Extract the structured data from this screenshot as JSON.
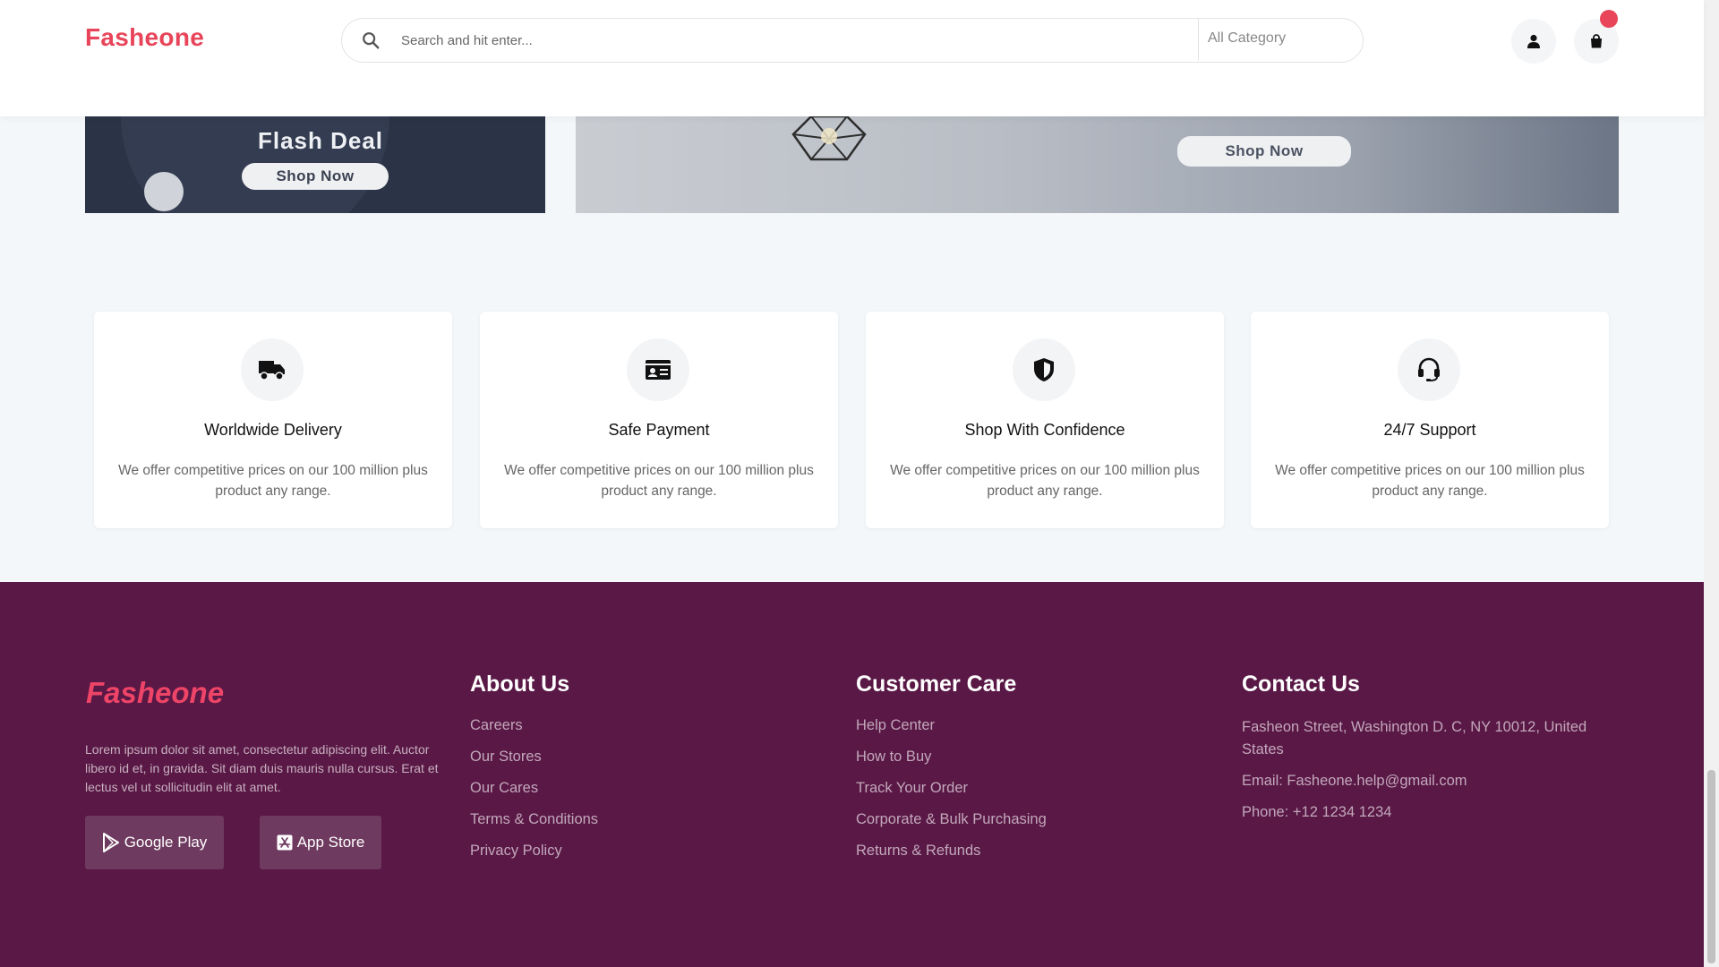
{
  "header": {
    "logo": "Fasheone",
    "search_placeholder": "Search and hit enter...",
    "category": "All Category",
    "accent": "#e8455a"
  },
  "banners": [
    {
      "title": "Flash Deal",
      "button": "Shop Now"
    },
    {
      "button": "Shop Now"
    }
  ],
  "features": [
    {
      "icon": "truck-icon",
      "title": "Worldwide Delivery",
      "desc": "We offer competitive prices on our 100 million plus product any range."
    },
    {
      "icon": "id-card-icon",
      "title": "Safe Payment",
      "desc": "We offer competitive prices on our 100 million plus product any range."
    },
    {
      "icon": "shield-icon",
      "title": "Shop With Confidence",
      "desc": "We offer competitive prices on our 100 million plus product any range."
    },
    {
      "icon": "headset-icon",
      "title": "24/7 Support",
      "desc": "We offer competitive prices on our 100 million plus product any range."
    }
  ],
  "footer": {
    "logo": "Fasheone",
    "description": "Lorem ipsum dolor sit amet, consectetur adipiscing elit. Auctor libero id et, in gravida. Sit diam duis mauris nulla cursus. Erat et lectus vel ut sollicitudin elit at amet.",
    "google_play": "Google Play",
    "app_store": "App Store",
    "about": {
      "heading": "About Us",
      "links": [
        "Careers",
        "Our Stores",
        "Our Cares",
        "Terms & Conditions",
        "Privacy Policy"
      ]
    },
    "care": {
      "heading": "Customer Care",
      "links": [
        "Help Center",
        "How to Buy",
        "Track Your Order",
        "Corporate & Bulk Purchasing",
        "Returns & Refunds"
      ]
    },
    "contact": {
      "heading": "Contact Us",
      "address": "Fasheon Street, Washington D. C, NY 10012, United States",
      "email": "Email: Fasheone.help@gmail.com",
      "phone": "Phone: +12 1234 1234"
    },
    "background": "#591845"
  }
}
